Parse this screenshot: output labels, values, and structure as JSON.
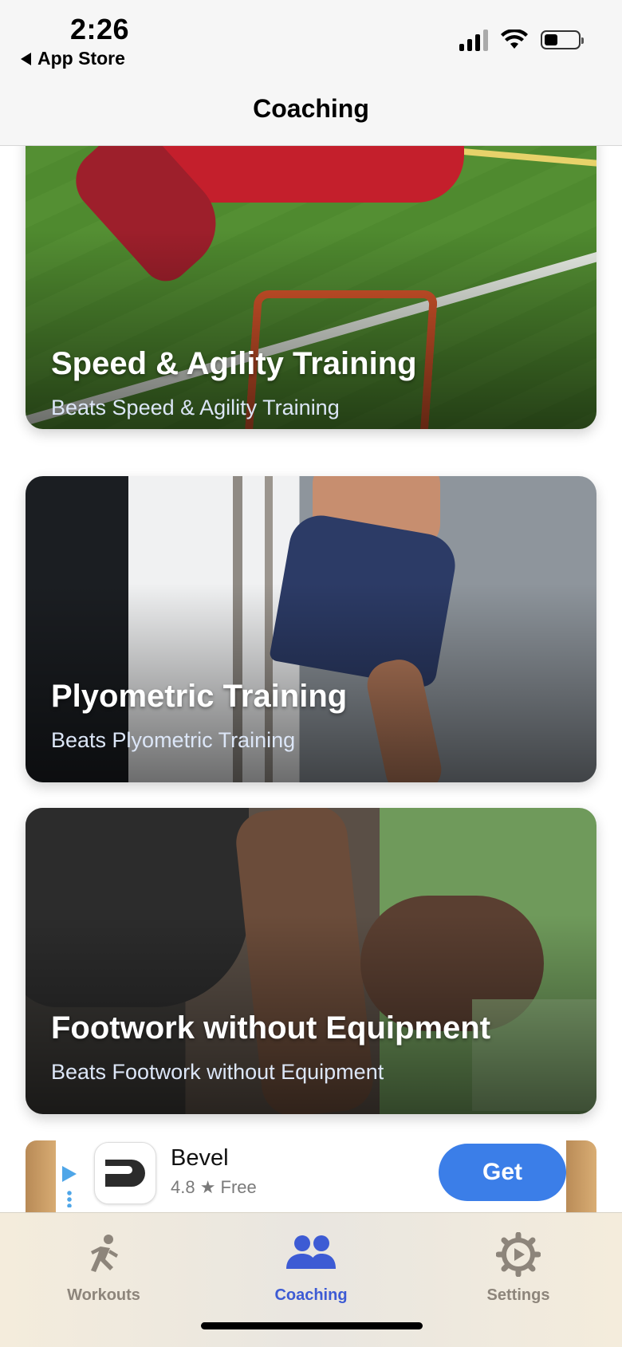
{
  "status_bar": {
    "time": "2:26",
    "back_label": "App Store"
  },
  "header": {
    "title": "Coaching"
  },
  "cards": [
    {
      "title": "Speed & Agility Training",
      "subtitle": "Beats Speed & Agility Training"
    },
    {
      "title": "Plyometric Training",
      "subtitle": "Beats Plyometric Training"
    },
    {
      "title": "Footwork without Equipment",
      "subtitle": "Beats Footwork without Equipment"
    }
  ],
  "ad": {
    "app_name": "Bevel",
    "rating": "4.8 ★  Free",
    "get_label": "Get"
  },
  "tabs": [
    {
      "label": "Workouts",
      "icon": "runner-icon",
      "active": false
    },
    {
      "label": "Coaching",
      "icon": "people-icon",
      "active": true
    },
    {
      "label": "Settings",
      "icon": "gear-icon",
      "active": false
    }
  ],
  "colors": {
    "accent": "#3d5bd4",
    "ad_button": "#3b7ee8",
    "inactive_tab": "#8d857b"
  }
}
